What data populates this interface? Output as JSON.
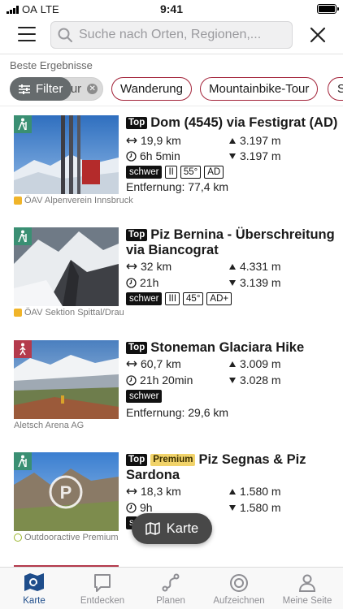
{
  "status": {
    "carrier": "OA",
    "network": "LTE",
    "time": "9:41"
  },
  "search": {
    "placeholder": "Suche nach Orten, Regionen,..."
  },
  "results_label": "Beste Ergebnisse",
  "filter_label": "Filter",
  "chips": [
    {
      "label": "Tour",
      "selected": true
    },
    {
      "label": "Wanderung"
    },
    {
      "label": "Mountainbike-Tour"
    },
    {
      "label": "S"
    }
  ],
  "results": [
    {
      "top": "Top",
      "premium": "",
      "title": "Dom (4545) via Festigrat (AD)",
      "distance": "19,9 km",
      "duration": "6h 5min",
      "ascent": "3.197 m",
      "descent": "3.197 m",
      "badges": [
        "schwer",
        "II",
        "55°",
        "AD"
      ],
      "entfernung": "Entfernung: 77,4 km",
      "source": "ÖAV Alpenverein Innsbruck",
      "category_icon": "hiking-person-teal-icon"
    },
    {
      "top": "Top",
      "premium": "",
      "title": "Piz Bernina - Überschreitung via Biancograt",
      "distance": "32 km",
      "duration": "21h",
      "ascent": "4.331 m",
      "descent": "3.139 m",
      "badges": [
        "schwer",
        "III",
        "45°",
        "AD+"
      ],
      "entfernung": "",
      "source": "ÖAV Sektion Spittal/Drau",
      "category_icon": "hiking-person-teal-icon"
    },
    {
      "top": "Top",
      "premium": "",
      "title": "Stoneman Glaciara Hike",
      "distance": "60,7 km",
      "duration": "21h 20min",
      "ascent": "3.009 m",
      "descent": "3.028 m",
      "badges": [
        "schwer"
      ],
      "entfernung": "Entfernung: 29,6 km",
      "source": "Aletsch Arena AG",
      "category_icon": "hiking-person-red-icon"
    },
    {
      "top": "Top",
      "premium": "Premium",
      "title": "Piz Segnas & Piz Sardona",
      "distance": "18,3 km",
      "duration": "9h",
      "ascent": "1.580 m",
      "descent": "1.580 m",
      "badges": [
        "s"
      ],
      "entfernung": "",
      "source": "Outdooractive Premium",
      "category_icon": "hiking-person-teal-icon"
    }
  ],
  "map_button": "Karte",
  "tabs": [
    {
      "label": "Karte",
      "icon": "map-search-icon",
      "active": true
    },
    {
      "label": "Entdecken",
      "icon": "speech-bubble-icon"
    },
    {
      "label": "Planen",
      "icon": "route-icon"
    },
    {
      "label": "Aufzeichnen",
      "icon": "record-icon"
    },
    {
      "label": "Meine Seite",
      "icon": "person-icon"
    }
  ],
  "colors": {
    "accent": "#a3243a",
    "tab_active": "#1e4d8b",
    "category_teal": "#3a8f73",
    "category_red": "#b43a4c",
    "premium": "#f1d36a"
  }
}
